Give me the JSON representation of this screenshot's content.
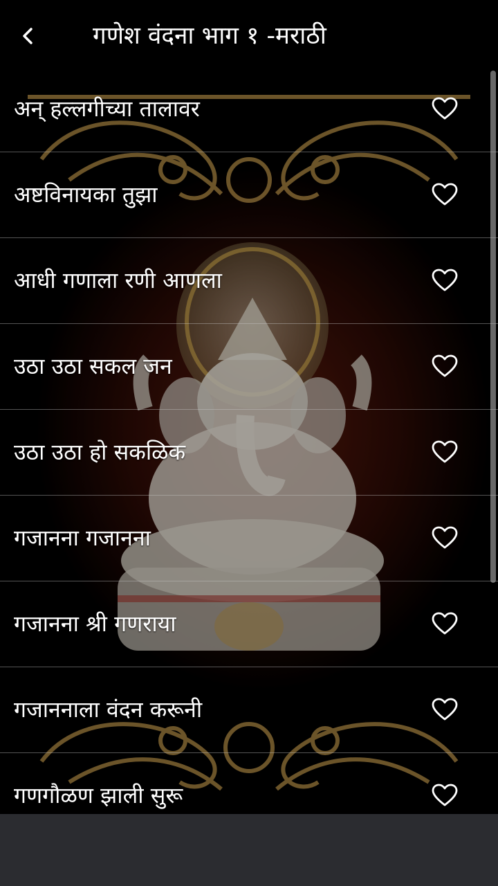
{
  "header": {
    "title": "गणेश वंदना भाग १ -मराठी",
    "back_icon": "chevron-left-icon"
  },
  "list": {
    "items": [
      {
        "label": "अन् हल्लगीच्या तालावर",
        "favorite": false
      },
      {
        "label": "अष्टविनायका तुझा",
        "favorite": false
      },
      {
        "label": "आधी गणाला रणी आणला",
        "favorite": false
      },
      {
        "label": "उठा उठा सकल जन",
        "favorite": false
      },
      {
        "label": "उठा उठा हो सकळिक",
        "favorite": false
      },
      {
        "label": "गजानना गजानना",
        "favorite": false
      },
      {
        "label": "गजानना श्री गणराया",
        "favorite": false
      },
      {
        "label": "गजाननाला वंदन करूनी",
        "favorite": false
      },
      {
        "label": "गणगौळण झाली सुरू",
        "favorite": false
      }
    ],
    "favorite_icon": "heart-outline-icon"
  },
  "theme": {
    "background": "#000000",
    "accent_gold": "#b08a45",
    "text": "#ffffff",
    "navbar": "#2b2c30"
  }
}
